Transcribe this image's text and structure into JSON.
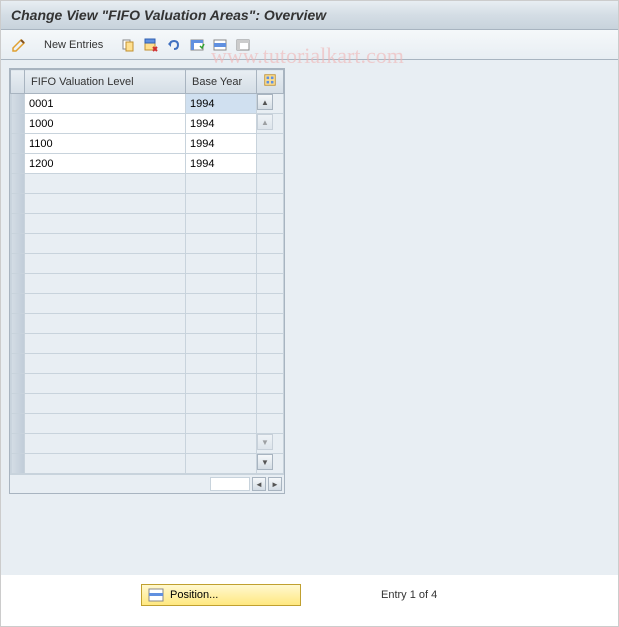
{
  "title": "Change View \"FIFO Valuation Areas\": Overview",
  "toolbar": {
    "new_entries_label": "New Entries"
  },
  "watermark": "www.tutorialkart.com",
  "table": {
    "headers": {
      "level": "FIFO Valuation Level",
      "year": "Base Year"
    },
    "rows": [
      {
        "level": "0001",
        "year": "1994",
        "year_selected": true
      },
      {
        "level": "1000",
        "year": "1994"
      },
      {
        "level": "1100",
        "year": "1994"
      },
      {
        "level": "1200",
        "year": "1994"
      }
    ],
    "empty_rows": 15
  },
  "footer": {
    "position_label": "Position...",
    "entry_status": "Entry 1 of 4"
  },
  "icons": {
    "pencil": "pencil",
    "copy": "copy",
    "select_delete": "select-delete",
    "undo": "undo",
    "select_all": "select-all",
    "deselect": "deselect",
    "save": "save",
    "settings": "settings"
  }
}
